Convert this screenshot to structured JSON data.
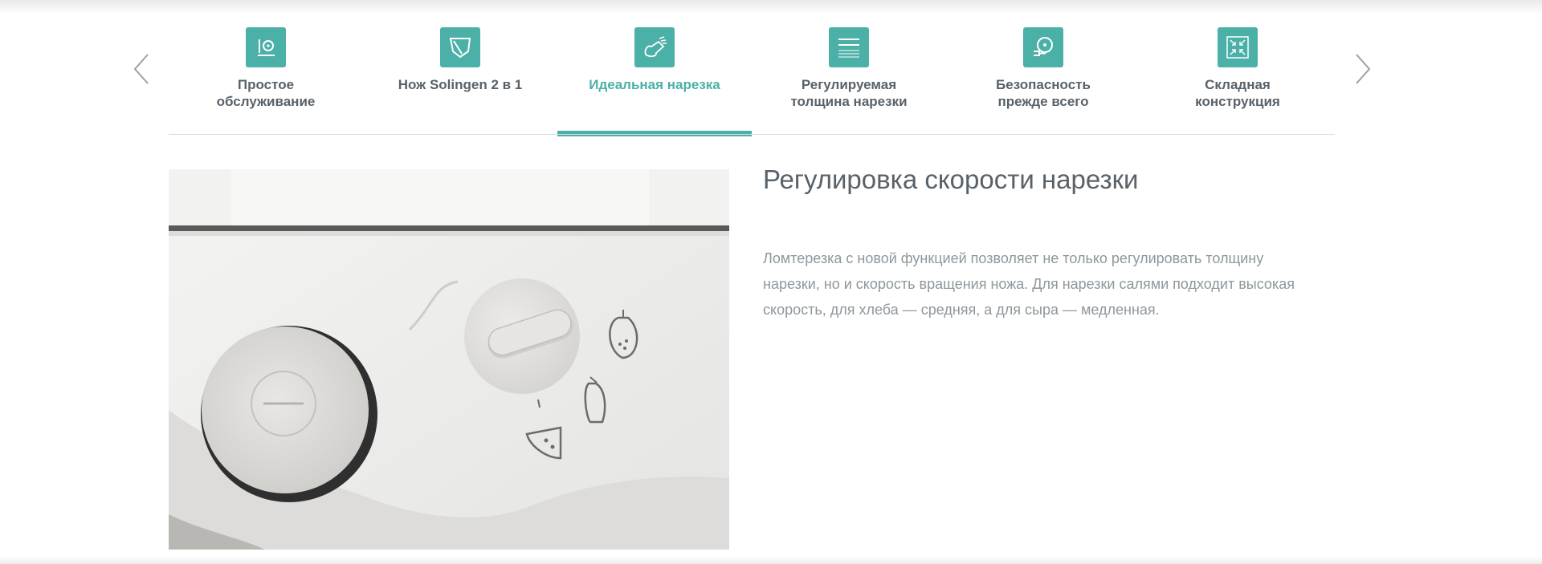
{
  "nav": {
    "prev_icon": "chevron-left-icon",
    "next_icon": "chevron-right-icon"
  },
  "tabs": [
    {
      "label": "Простое обслуживание",
      "icon": "cleaning-icon"
    },
    {
      "label": "Нож Solingen 2 в 1",
      "icon": "blade-icon"
    },
    {
      "label": "Идеальная нарезка",
      "icon": "slice-icon"
    },
    {
      "label": "Регулируемая толщина нарезки",
      "icon": "thickness-lines-icon"
    },
    {
      "label": "Безопасность прежде всего",
      "icon": "safety-guard-icon"
    },
    {
      "label": "Складная конструкция",
      "icon": "fold-compress-icon"
    }
  ],
  "active_tab_index": 2,
  "content": {
    "title": "Регулировка скорости нарезки",
    "description": "Ломтерезка с новой функцией позволяет не только регулировать толщину нарезки, но и скорость вращения ножа. Для нарезки салями подходит высокая скорость, для хлеба — средняя, а для сыра — медленная.",
    "image_alt": "speed-dial-photo"
  },
  "colors": {
    "accent": "#4bb0a7",
    "text_dark": "#58626a",
    "text_muted": "#8e979c",
    "divider": "#d6dcdc"
  }
}
